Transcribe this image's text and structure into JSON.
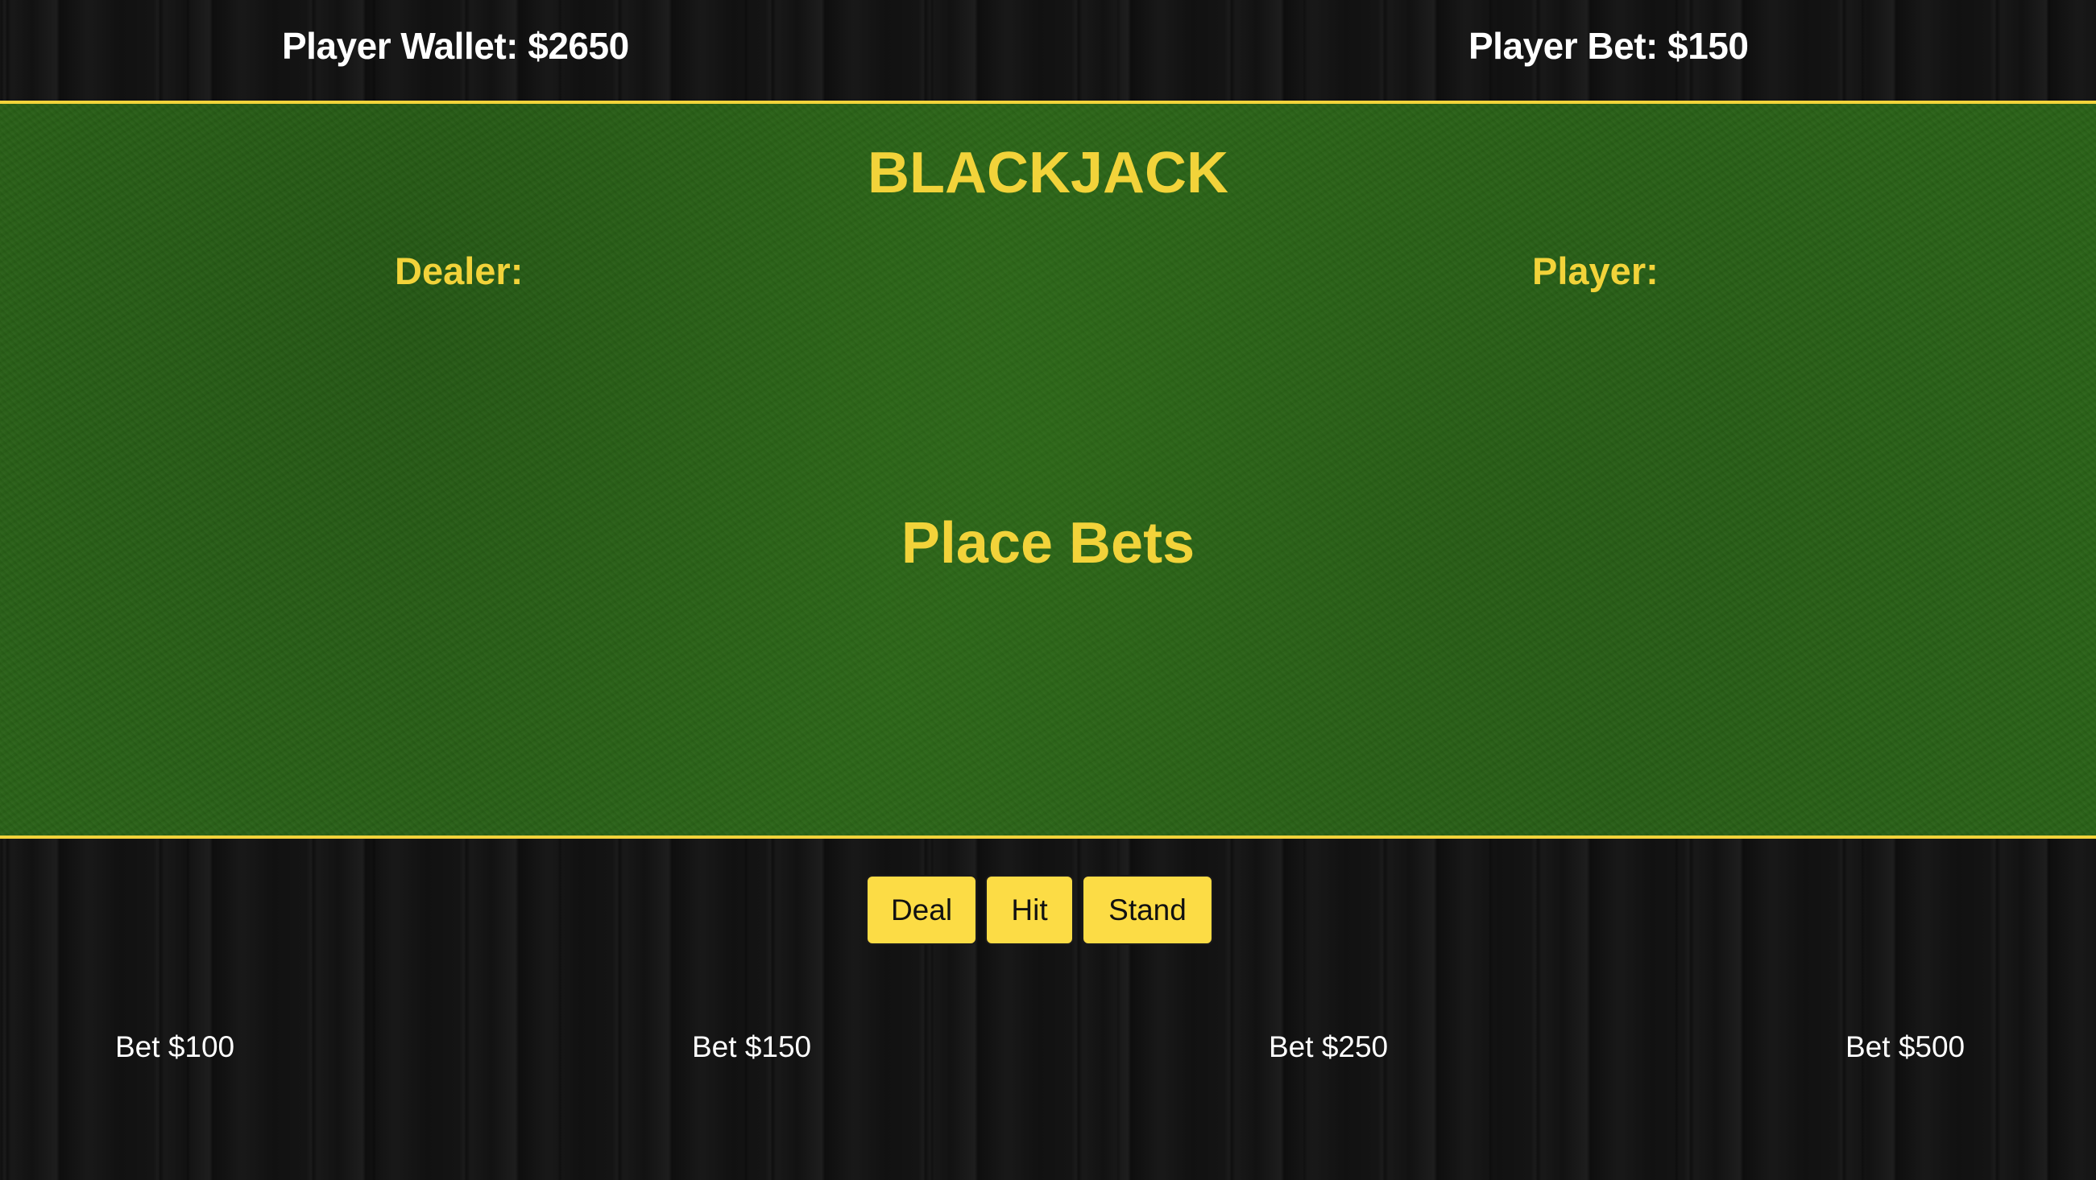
{
  "header": {
    "wallet_text": "Player Wallet: $2650",
    "bet_text": "Player Bet: $150"
  },
  "table": {
    "title": "BLACKJACK",
    "dealer_label": "Dealer:",
    "player_label": "Player:",
    "status_message": "Place Bets"
  },
  "actions": {
    "deal_label": "Deal",
    "hit_label": "Hit",
    "stand_label": "Stand"
  },
  "bets": [
    {
      "label": "Bet $100"
    },
    {
      "label": "Bet $150"
    },
    {
      "label": "Bet $250"
    },
    {
      "label": "Bet $500"
    }
  ],
  "colors": {
    "accent_gold": "#f2d33a",
    "button_yellow": "#fcdc45",
    "felt_green": "#2a6218",
    "wood_dark": "#141414"
  }
}
